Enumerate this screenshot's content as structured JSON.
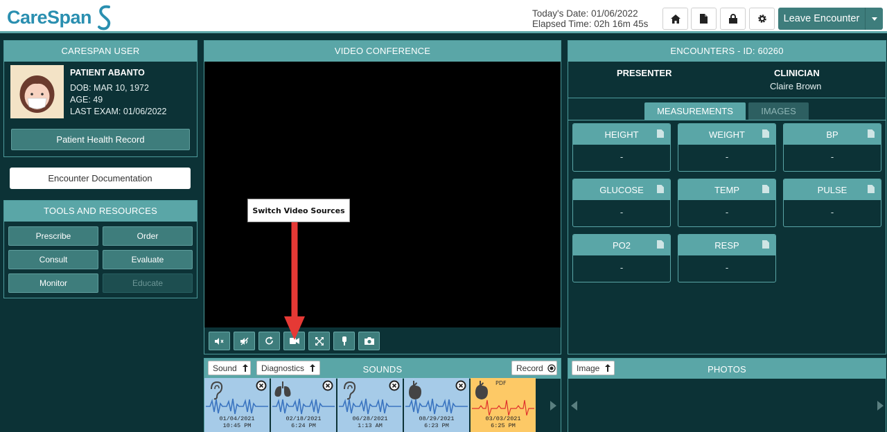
{
  "header": {
    "logo_text": "CareSpan",
    "today_date": "Today's Date: 01/06/2022",
    "elapsed_time": "Elapsed Time: 02h 16m 45s",
    "leave_label": "Leave Encounter"
  },
  "user_panel": {
    "title": "CARESPAN USER",
    "patient_name": "PATIENT ABANTO",
    "dob": "DOB: MAR 10, 1972",
    "age": "AGE: 49",
    "last_exam": "LAST EXAM: 01/06/2022",
    "health_record_label": "Patient Health Record"
  },
  "encounter_doc_label": "Encounter Documentation",
  "tools": {
    "title": "TOOLS AND RESOURCES",
    "buttons": [
      "Prescribe",
      "Order",
      "Consult",
      "Evaluate",
      "Monitor",
      "Educate"
    ]
  },
  "video": {
    "title": "VIDEO CONFERENCE",
    "tooltip": "Switch Video Sources"
  },
  "encounters": {
    "title": "ENCOUNTERS - ID: 60260",
    "presenter_label": "PRESENTER",
    "clinician_label": "CLINICIAN",
    "clinician_name": "Claire Brown",
    "tabs": [
      "MEASUREMENTS",
      "IMAGES"
    ],
    "measurements": [
      {
        "label": "HEIGHT",
        "value": "-"
      },
      {
        "label": "WEIGHT",
        "value": "-"
      },
      {
        "label": "BP",
        "value": "-"
      },
      {
        "label": "GLUCOSE",
        "value": "-"
      },
      {
        "label": "TEMP",
        "value": "-"
      },
      {
        "label": "PULSE",
        "value": "-"
      },
      {
        "label": "PO2",
        "value": "-"
      },
      {
        "label": "RESP",
        "value": "-"
      }
    ]
  },
  "sounds": {
    "title": "SOUNDS",
    "sound_btn": "Sound",
    "diagnostics_btn": "Diagnostics",
    "record_btn": "Record",
    "items": [
      {
        "icon": "ear-icon",
        "date": "01/04/2021",
        "time": "10:45 PM"
      },
      {
        "icon": "lungs-icon",
        "date": "02/18/2021",
        "time": "6:24 PM"
      },
      {
        "icon": "ear-icon",
        "date": "06/28/2021",
        "time": "1:13 AM"
      },
      {
        "icon": "heart-icon",
        "date": "08/29/2021",
        "time": "6:23 PM"
      },
      {
        "icon": "heart-icon",
        "badge": "PDF",
        "date": "03/03/2021",
        "time": "6:25 PM"
      }
    ]
  },
  "photos": {
    "title": "PHOTOS",
    "image_btn": "Image"
  },
  "colors": {
    "teal_header": "#5aa6a7",
    "teal_button": "#3e7d7c",
    "background": "#0c3236",
    "brand_blue": "#2a8fb0",
    "arrow_red": "#e53935"
  }
}
